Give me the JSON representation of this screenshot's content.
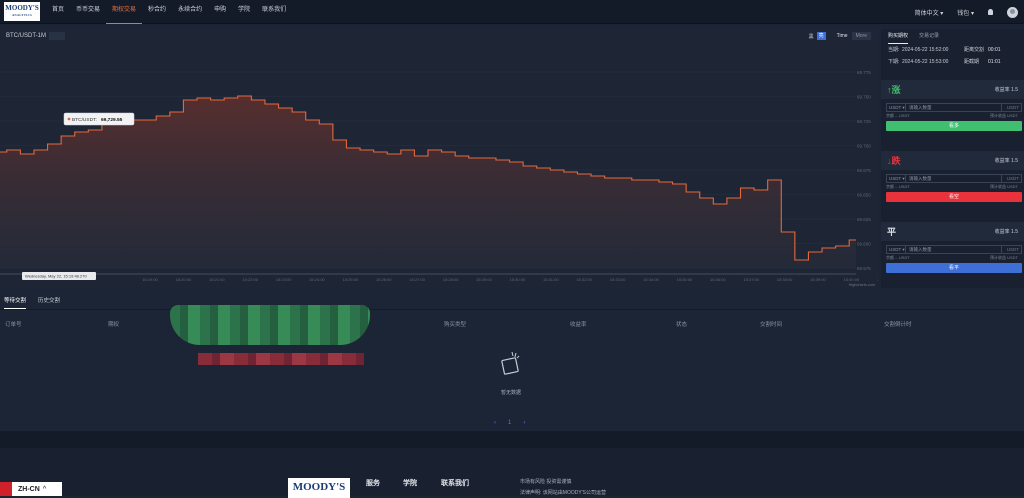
{
  "logo": {
    "main": "MOODY'S",
    "sub": "ANALYTICS"
  },
  "nav": {
    "items": [
      "首页",
      "币币交易",
      "期权交易",
      "秒合约",
      "永续合约",
      "申购",
      "学院",
      "联系我们"
    ],
    "active_index": 2
  },
  "topbar": {
    "language": "简体中文",
    "wallet": "钱包",
    "bell_icon": "bell-icon",
    "avatar_icon": "avatar-icon"
  },
  "chart_header": {
    "pair": "BTC/USDT-1M",
    "mode_dark": "黑",
    "mode_light": "亮",
    "seg_time": "Time",
    "seg_more": "More"
  },
  "chart_data": {
    "type": "line",
    "y_ticks": [
      "69.775",
      "69.750",
      "69.725",
      "69.700",
      "69.675",
      "69.650",
      "69.625",
      "69.600",
      "69.575"
    ],
    "x_ticks": [
      "15:19:00",
      "15:20:00",
      "15:21:00",
      "15:22:00",
      "15:23:00",
      "15:24:00",
      "15:25:00",
      "15:26:00",
      "15:27:00",
      "15:28:00",
      "15:29:00",
      "15:30:00",
      "15:31:00",
      "15:32:00",
      "15:33:00",
      "15:34:00",
      "15:35:00",
      "15:36:00",
      "15:37:00",
      "15:38:00",
      "15:39:00",
      "15:40:00",
      "15:41:00"
    ],
    "tooltip": {
      "series": "BTC/USDT",
      "value": "69,729.55"
    },
    "crosshair_label": "Wednesday, May 22, 15:19:48.270",
    "credit": "Highcharts.com",
    "line_color": "#e5683a",
    "series_shape": [
      0.56,
      0.57,
      0.55,
      0.57,
      0.6,
      0.64,
      0.66,
      0.67,
      0.72,
      0.72,
      0.72,
      0.72,
      0.74,
      0.76,
      0.82,
      0.83,
      0.82,
      0.83,
      0.84,
      0.82,
      0.8,
      0.78,
      0.76,
      0.72,
      0.7,
      0.62,
      0.58,
      0.57,
      0.56,
      0.55,
      0.57,
      0.54,
      0.57,
      0.56,
      0.54,
      0.53,
      0.53,
      0.52,
      0.51,
      0.49,
      0.48,
      0.47,
      0.46,
      0.45,
      0.44,
      0.43,
      0.43,
      0.42,
      0.42,
      0.41,
      0.4,
      0.36,
      0.33,
      0.3,
      0.33,
      0.38,
      0.37,
      0.42,
      0.16,
      0.02,
      0.06,
      0.08,
      0.09,
      0.12
    ]
  },
  "trade": {
    "tabs": [
      "购买期权",
      "交易记录"
    ],
    "current_label": "当期:",
    "current_time": "2024-05-22 15:52:00",
    "countdown_label": "距离交割",
    "countdown": "00:01",
    "next_label": "下期:",
    "next_time": "2024-05-22 15:53:00",
    "delivery_label": "距截期",
    "delivery": "01:01",
    "blocks": [
      {
        "dir": "↑涨",
        "yield_label": "收益率",
        "yield": "1.5",
        "unit": "USDT",
        "placeholder": "请输入数量",
        "balance_label": "余额",
        "balance": "-- USDT",
        "expected_label": "预计收益",
        "expected": "USDT",
        "button": "看多"
      },
      {
        "dir": "↓跌",
        "yield_label": "收益率",
        "yield": "1.5",
        "unit": "USDT",
        "placeholder": "请输入数量",
        "balance_label": "余额",
        "balance": "-- USDT",
        "expected_label": "预计收益",
        "expected": "USDT",
        "button": "看空"
      },
      {
        "dir": "平",
        "yield_label": "收益率",
        "yield": "1.5",
        "unit": "USDT",
        "placeholder": "请输入数量",
        "balance_label": "余额",
        "balance": "-- USDT",
        "expected_label": "预计收益",
        "expected": "USDT",
        "button": "看平"
      }
    ]
  },
  "orders": {
    "tabs": [
      "等待交割",
      "历史交割"
    ],
    "columns": [
      "订单号",
      "期权",
      "购买类型",
      "收益率",
      "状态",
      "交割时间",
      "交割倒计时"
    ],
    "empty": "暂无数据",
    "page": "1"
  },
  "footer": {
    "logo": "MOODY'S",
    "links": [
      "服务",
      "学院",
      "联系我们"
    ],
    "note1": "市场有风险 投资需谨慎",
    "note2": "法律声明: 该网站由MOODY'S公司运营",
    "lang": "ZH-CN"
  }
}
